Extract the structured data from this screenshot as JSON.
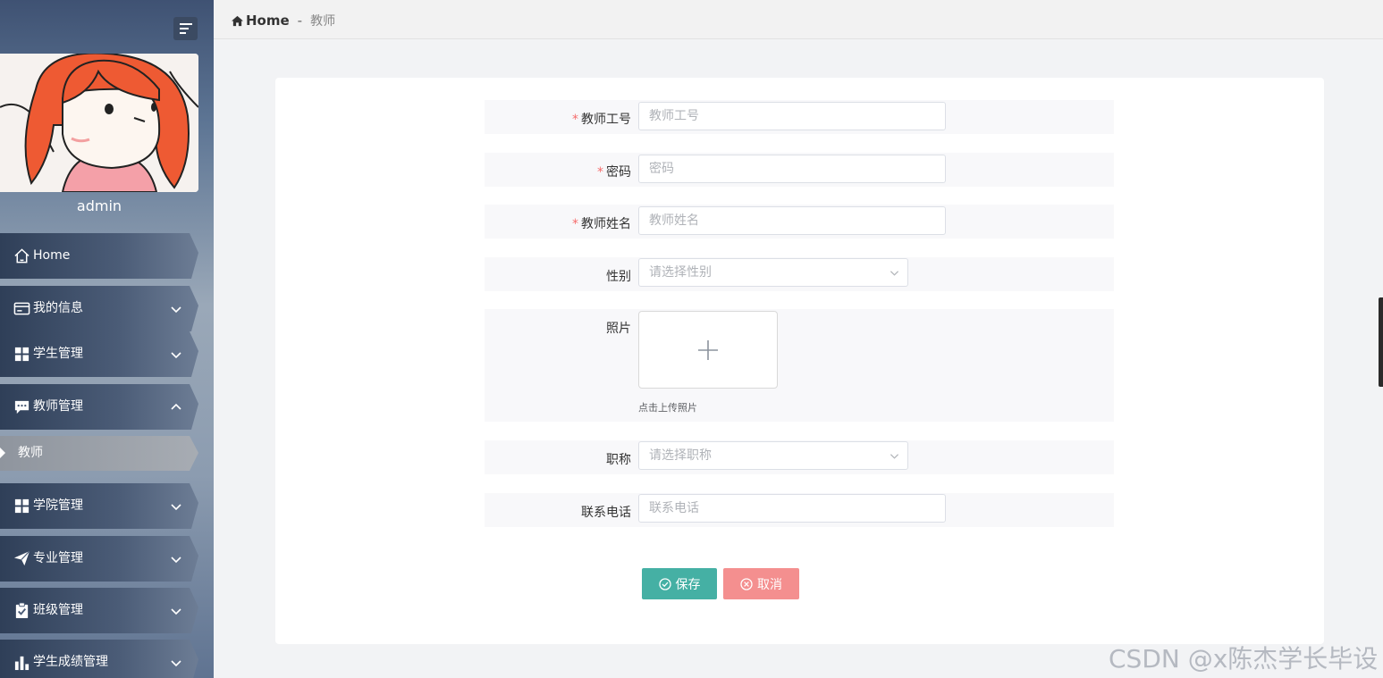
{
  "sidebar": {
    "username": "admin",
    "menu": [
      {
        "label": "Home",
        "icon": "home-icon"
      },
      {
        "label": "我的信息",
        "icon": "id-card-icon"
      },
      {
        "label": "学生管理",
        "icon": "grid-icon"
      },
      {
        "label": "教师管理",
        "icon": "chat-icon"
      },
      {
        "label": "学院管理",
        "icon": "grid-icon"
      },
      {
        "label": "专业管理",
        "icon": "paper-plane-icon"
      },
      {
        "label": "班级管理",
        "icon": "clipboard-check-icon"
      },
      {
        "label": "学生成绩管理",
        "icon": "bar-chart-icon"
      }
    ],
    "submenu_active": "教师"
  },
  "breadcrumb": {
    "home": "Home",
    "separator": "-",
    "current": "教师"
  },
  "form": {
    "teacher_id": {
      "label": "教师工号",
      "placeholder": "教师工号",
      "required": true
    },
    "password": {
      "label": "密码",
      "placeholder": "密码",
      "required": true
    },
    "teacher_name": {
      "label": "教师姓名",
      "placeholder": "教师姓名",
      "required": true
    },
    "gender": {
      "label": "性别",
      "placeholder": "请选择性别"
    },
    "photo": {
      "label": "照片",
      "tip": "点击上传照片"
    },
    "title": {
      "label": "职称",
      "placeholder": "请选择职称"
    },
    "phone": {
      "label": "联系电话",
      "placeholder": "联系电话"
    },
    "required_mark": "*"
  },
  "buttons": {
    "save": "保存",
    "cancel": "取消"
  },
  "watermark": "CSDN @x陈杰学长毕设",
  "colors": {
    "save": "#45b0a4",
    "cancel": "#f48f8f",
    "required": "#f56c6c"
  }
}
